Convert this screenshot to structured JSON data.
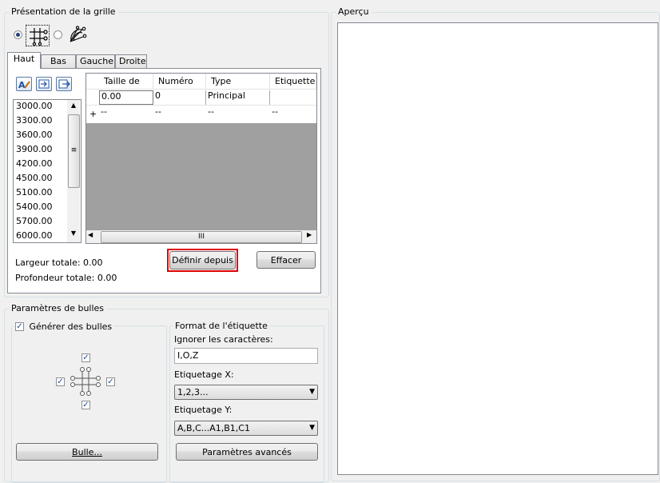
{
  "grid_section": {
    "title": "Présentation de la grille",
    "tabs": [
      "Haut",
      "Bas",
      "Gauche",
      "Droite"
    ],
    "list_values": [
      "3000.00",
      "3300.00",
      "3600.00",
      "3900.00",
      "4200.00",
      "4500.00",
      "5100.00",
      "5400.00",
      "5700.00",
      "6000.00"
    ],
    "table": {
      "headers": [
        "Taille de",
        "Numéro",
        "Type",
        "Etiquette"
      ],
      "rows": [
        [
          "0.00",
          "0",
          "Principal",
          ""
        ],
        [
          "--",
          "--",
          "--",
          "--"
        ]
      ],
      "new_row_marker": "+"
    },
    "scroll_middle": "III",
    "define_from_button": "Définir depuis",
    "clear_button": "Effacer",
    "total_width": "Largeur totale: 0.00",
    "total_depth": "Profondeur totale: 0.00"
  },
  "bubble_section": {
    "title": "Paramètres de bulles",
    "generate_label": "Générer des bulles",
    "bubble_button": "Bulle...",
    "label_format": {
      "title": "Format de l'étiquette",
      "ignore_label": "Ignorer les caractères:",
      "ignore_value": "I,O,Z",
      "x_label": "Etiquetage X:",
      "x_value": "1,2,3...",
      "y_label": "Etiquetage Y:",
      "y_value": "A,B,C...A1,B1,C1",
      "advanced_button": "Paramètres avancés"
    }
  },
  "preview_section": {
    "title": "Aperçu"
  },
  "colors": {
    "highlight_border": "#e00000",
    "grid_gray": "#a0a0a0",
    "group_border": "#d5dfe5"
  }
}
